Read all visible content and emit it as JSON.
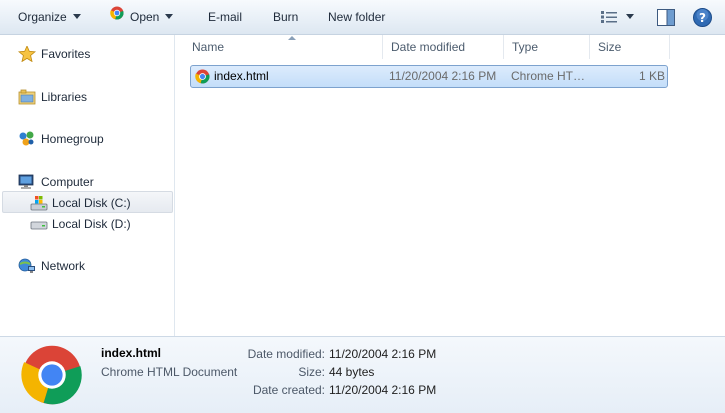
{
  "toolbar": {
    "organize": "Organize",
    "open": "Open",
    "email": "E-mail",
    "burn": "Burn",
    "new_folder": "New folder"
  },
  "nav": {
    "favorites": "Favorites",
    "libraries": "Libraries",
    "homegroup": "Homegroup",
    "computer": "Computer",
    "local_c": "Local Disk (C:)",
    "local_d": "Local Disk (D:)",
    "network": "Network"
  },
  "columns": {
    "name": "Name",
    "date_modified": "Date modified",
    "type": "Type",
    "size": "Size"
  },
  "files": [
    {
      "name": "index.html",
      "date_modified": "11/20/2004 2:16 PM",
      "type": "Chrome HT…",
      "size": "1 KB"
    }
  ],
  "details": {
    "name": "index.html",
    "type": "Chrome HTML Document",
    "labels": {
      "date_modified": "Date modified:",
      "size": "Size:",
      "date_created": "Date created:"
    },
    "values": {
      "date_modified": "11/20/2004 2:16 PM",
      "size": "44 bytes",
      "date_created": "11/20/2004 2:16 PM"
    }
  },
  "colors": {
    "selection_fill": "#c4def9",
    "selection_border": "#7da2ce",
    "toolbar_bg": "#eaf1f8"
  },
  "icons": {
    "open": "chrome-icon",
    "views": "views-icon",
    "preview_pane": "preview-pane-icon",
    "help": "help-icon",
    "favorites": "star-icon",
    "libraries": "libraries-icon",
    "homegroup": "homegroup-icon",
    "computer": "computer-icon",
    "local_c": "system-drive-icon",
    "local_d": "drive-icon",
    "network": "network-icon"
  }
}
